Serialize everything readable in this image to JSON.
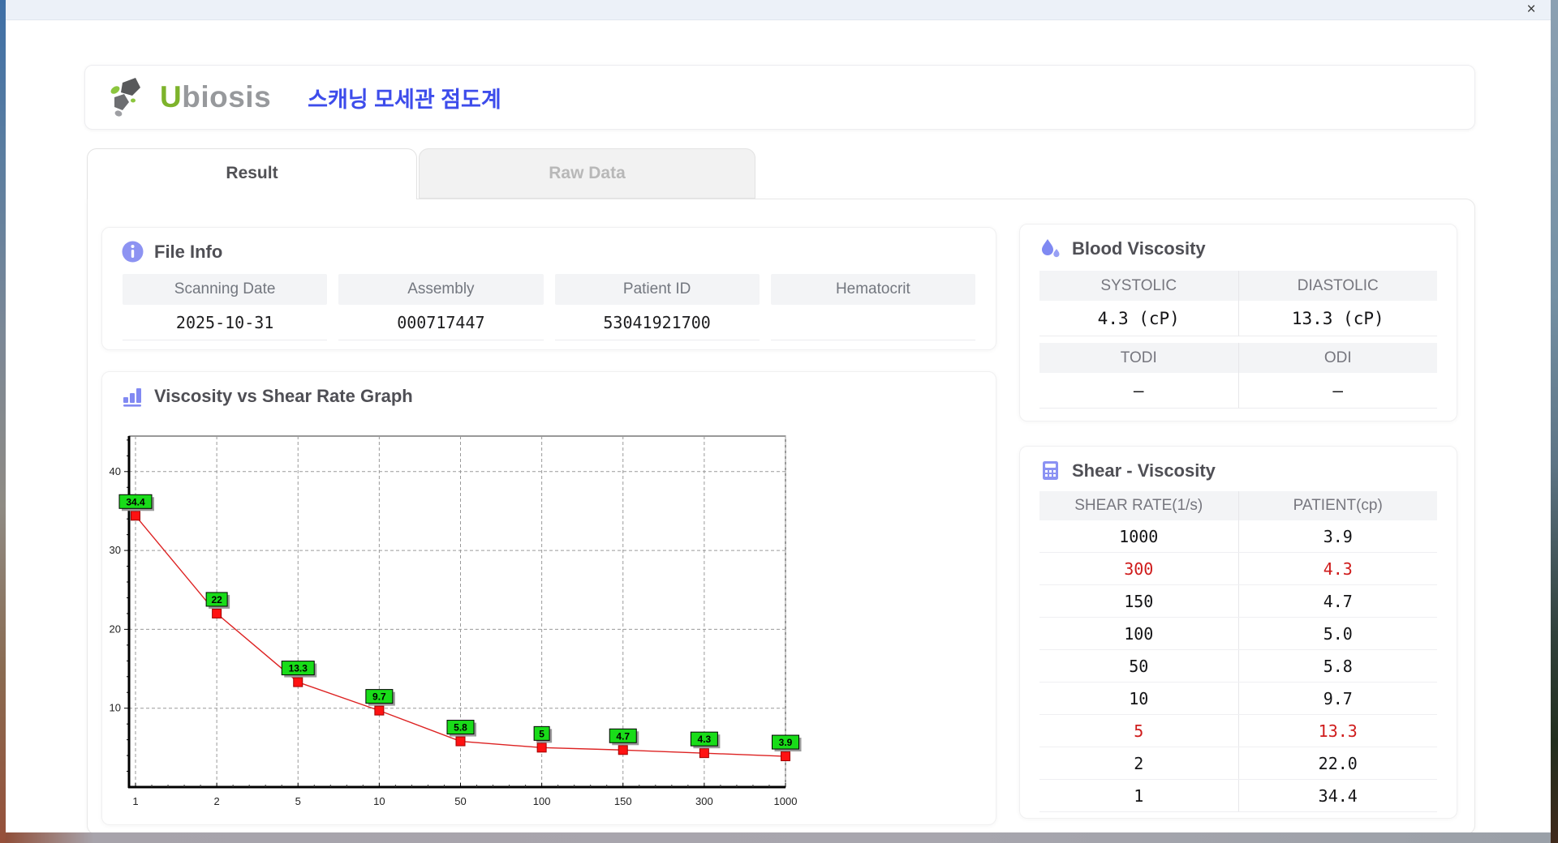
{
  "window": {
    "close_label": "×"
  },
  "header": {
    "brand_first": "U",
    "brand_rest": "biosis",
    "title_ko": "스캐닝 모세관 점도계"
  },
  "tabs": {
    "result": "Result",
    "raw_data": "Raw Data"
  },
  "file_info": {
    "title": "File Info",
    "fields": [
      {
        "label": "Scanning Date",
        "value": "2025-10-31"
      },
      {
        "label": "Assembly",
        "value": "000717447"
      },
      {
        "label": "Patient ID",
        "value": "53041921700"
      },
      {
        "label": "Hematocrit",
        "value": ""
      }
    ]
  },
  "blood_viscosity": {
    "title": "Blood Viscosity",
    "groups": [
      {
        "cols": [
          {
            "label": "SYSTOLIC",
            "value": "4.3 (cP)"
          },
          {
            "label": "DIASTOLIC",
            "value": "13.3 (cP)"
          }
        ]
      },
      {
        "cols": [
          {
            "label": "TODI",
            "value": "–"
          },
          {
            "label": "ODI",
            "value": "–"
          }
        ]
      }
    ]
  },
  "graph": {
    "title": "Viscosity vs Shear Rate Graph"
  },
  "chart_data": {
    "type": "line",
    "title": "Viscosity vs Shear Rate Graph",
    "xlabel": "",
    "ylabel": "",
    "x_categories": [
      "1",
      "2",
      "5",
      "10",
      "50",
      "100",
      "150",
      "300",
      "1000"
    ],
    "values": [
      34.4,
      22,
      13.3,
      9.7,
      5.8,
      5,
      4.7,
      4.3,
      3.9
    ],
    "point_labels": [
      "34.4",
      "22",
      "13.3",
      "9.7",
      "5.8",
      "5",
      "4.7",
      "4.3",
      "3.9"
    ],
    "ylim": [
      0,
      44.5
    ],
    "yticks": [
      10,
      20,
      30,
      40
    ],
    "grid": true,
    "legend": "none",
    "line_color": "#dd2222",
    "marker_color": "#ff1212",
    "marker_edge": "#a00000",
    "label_bg": "#19dc19",
    "label_border": "#000000"
  },
  "shear_table": {
    "title": "Shear - Viscosity",
    "headers": [
      "SHEAR RATE(1/s)",
      "PATIENT(cp)"
    ],
    "rows": [
      {
        "shear": "1000",
        "patient": "3.9",
        "highlight": false
      },
      {
        "shear": "300",
        "patient": "4.3",
        "highlight": true
      },
      {
        "shear": "150",
        "patient": "4.7",
        "highlight": false
      },
      {
        "shear": "100",
        "patient": "5.0",
        "highlight": false
      },
      {
        "shear": "50",
        "patient": "5.8",
        "highlight": false
      },
      {
        "shear": "10",
        "patient": "9.7",
        "highlight": false
      },
      {
        "shear": "5",
        "patient": "13.3",
        "highlight": true
      },
      {
        "shear": "2",
        "patient": "22.0",
        "highlight": false
      },
      {
        "shear": "1",
        "patient": "34.4",
        "highlight": false
      }
    ]
  },
  "colors": {
    "accent_purple": "#8189f2",
    "brand_green": "#7db32b",
    "brand_gray": "#97999c",
    "title_blue": "#3d4ceb",
    "alert_red": "#cf1b1b"
  }
}
